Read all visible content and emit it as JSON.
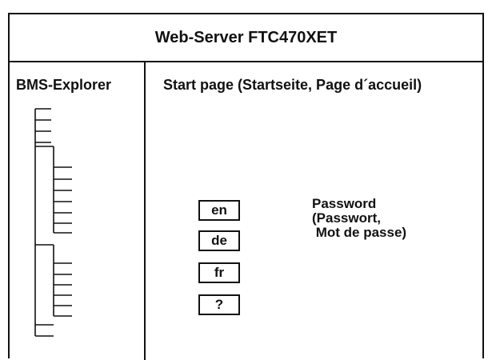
{
  "header": {
    "title": "Web-Server FTC470XET"
  },
  "sidebar": {
    "title": "BMS-Explorer"
  },
  "main": {
    "title": "Start page (Startseite, Page d´accueil)",
    "language_buttons": [
      {
        "label": "en"
      },
      {
        "label": "de"
      },
      {
        "label": "fr"
      },
      {
        "label": "?"
      }
    ],
    "password": {
      "line1": "Password",
      "line2": "(Passwort,",
      "line3": " Mot de passe)"
    }
  }
}
